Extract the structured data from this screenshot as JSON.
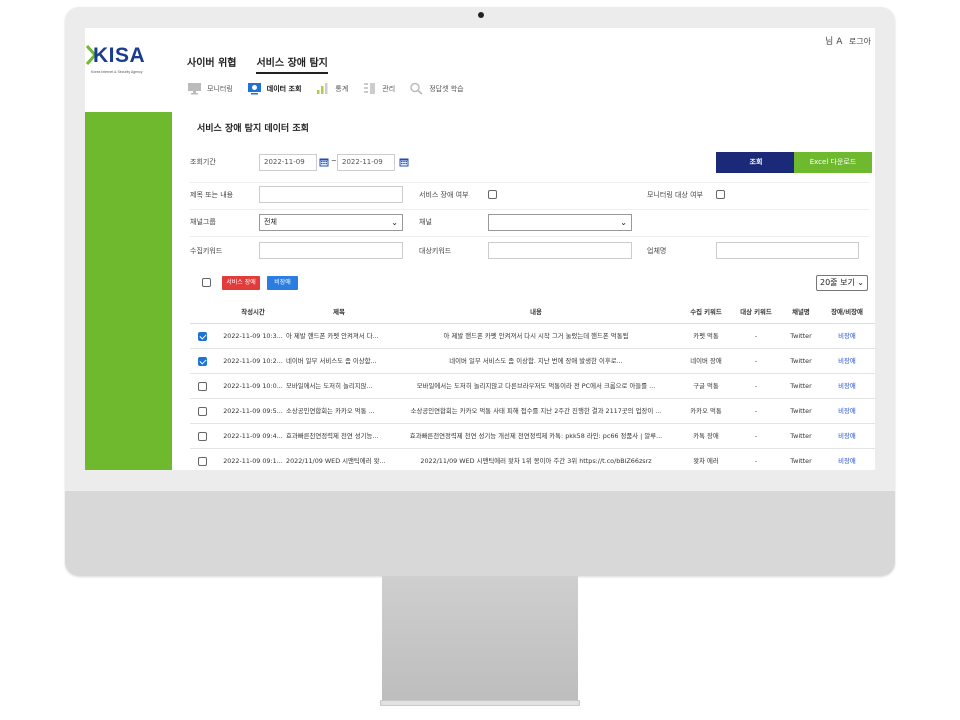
{
  "app": {
    "logo_text": "KISA",
    "logo_subtext": "Korea Internet & Security Agency",
    "user_label": "님 A",
    "logout_label": "로그아"
  },
  "main_nav": [
    {
      "label": "사이버 위협",
      "active": false
    },
    {
      "label": "서비스 장애 탐지",
      "active": true
    }
  ],
  "sub_nav": [
    {
      "label": "모니터링",
      "icon": "monitor-icon",
      "active": false
    },
    {
      "label": "데이터 조회",
      "icon": "data-view-icon",
      "active": true
    },
    {
      "label": "통계",
      "icon": "bar-chart-icon",
      "active": false
    },
    {
      "label": "관리",
      "icon": "manage-icon",
      "active": false
    },
    {
      "label": "정답셋 학습",
      "icon": "search-icon",
      "active": false
    }
  ],
  "page": {
    "title": "서비스 장애 탐지 데이터 조회"
  },
  "filters": {
    "period_label": "조회기간",
    "date_from": "2022-11-09",
    "date_sep": "~",
    "date_to": "2022-11-09",
    "search_button": "조회",
    "excel_button": "Excel 다운로드",
    "title_or_content_label": "제목 또는 내용",
    "title_or_content_value": "",
    "service_outage_label": "서비스 장애 여부",
    "service_outage_checked": false,
    "monitoring_target_label": "모니터링 대상 여부",
    "monitoring_target_checked": false,
    "channel_group_label": "채널그룹",
    "channel_group_value": "전체",
    "channel_label": "채널",
    "channel_value": "",
    "collect_keyword_label": "수집키워드",
    "collect_keyword_value": "",
    "target_keyword_label": "대상키워드",
    "target_keyword_value": "",
    "company_label": "업체명",
    "company_value": ""
  },
  "actions": {
    "mark_outage": "서비스 장애",
    "mark_non_outage": "비장애",
    "page_size": "20줄 보기"
  },
  "table": {
    "columns": [
      "작성시간",
      "제목",
      "내용",
      "수집 키워드",
      "대상 키워드",
      "채널명",
      "장애/비장애"
    ],
    "rows": [
      {
        "checked": true,
        "time": "2022-11-09 10:3...",
        "title": "아 제발 핸드폰 카펫 안켜져서 다...",
        "content": "아 제발 핸드폰 카펫 안켜져서 다시 시작 그거 눌렀는데 핸드폰 먹통됨",
        "keyword": "카펫 먹통",
        "target_keyword": "-",
        "channel": "Twitter",
        "status": "비장애"
      },
      {
        "checked": true,
        "time": "2022-11-09 10:2...",
        "title": "네이버 일부 서비스도 좀 이상함...",
        "content": "네이버 일부 서비스도 좀 이상함. 지난 번에 장애 발생한 이후로...",
        "keyword": "네이버 장애",
        "target_keyword": "-",
        "channel": "Twitter",
        "status": "비장애"
      },
      {
        "checked": false,
        "time": "2022-11-09 10:0...",
        "title": "모바일에서는 도저히 놀리지않...",
        "content": "모바일에서는 도저히 놀리지않고 다른브라우저도 먹통이라 전 PC에서 크롬으로 아들를 ...",
        "keyword": "구글 먹통",
        "target_keyword": "-",
        "channel": "Twitter",
        "status": "비장애"
      },
      {
        "checked": false,
        "time": "2022-11-09 09:5...",
        "title": "소상공인연합회는 카카오 먹통 ...",
        "content": "소상공인연합회는 카카오 먹통 사태 피해 접수를 지난 2주간 진행한 결과 2117곳의 업장이 ...",
        "keyword": "카카오 먹통",
        "target_keyword": "-",
        "channel": "Twitter",
        "status": "비장애"
      },
      {
        "checked": false,
        "time": "2022-11-09 09:4...",
        "title": "효과빠른천연정력제 천연 성기능...",
        "content": "효과빠른천연정력제 천연 성기능 개선제 천연정력제 카톡: pkk58 라인: pc66 정품사 | 알루...",
        "keyword": "카톡 장애",
        "target_keyword": "-",
        "channel": "Twitter",
        "status": "비장애"
      },
      {
        "checked": false,
        "time": "2022-11-09 09:1...",
        "title": "2022/11/09 WED 시맨틱에러 왓...",
        "content": "2022/11/09 WED 시맨틱에러 왓차 1위 몽이아 주간 3위 https://t.co/bBlZ66zsrz",
        "keyword": "왓차 에러",
        "target_keyword": "-",
        "channel": "Twitter",
        "status": "비장애"
      }
    ]
  },
  "colors": {
    "brand_green": "#6fb92e",
    "brand_navy": "#1a2a78",
    "outage_red": "#e23b3b",
    "non_outage_blue": "#2b7de0",
    "link_blue": "#1f4fd8"
  }
}
